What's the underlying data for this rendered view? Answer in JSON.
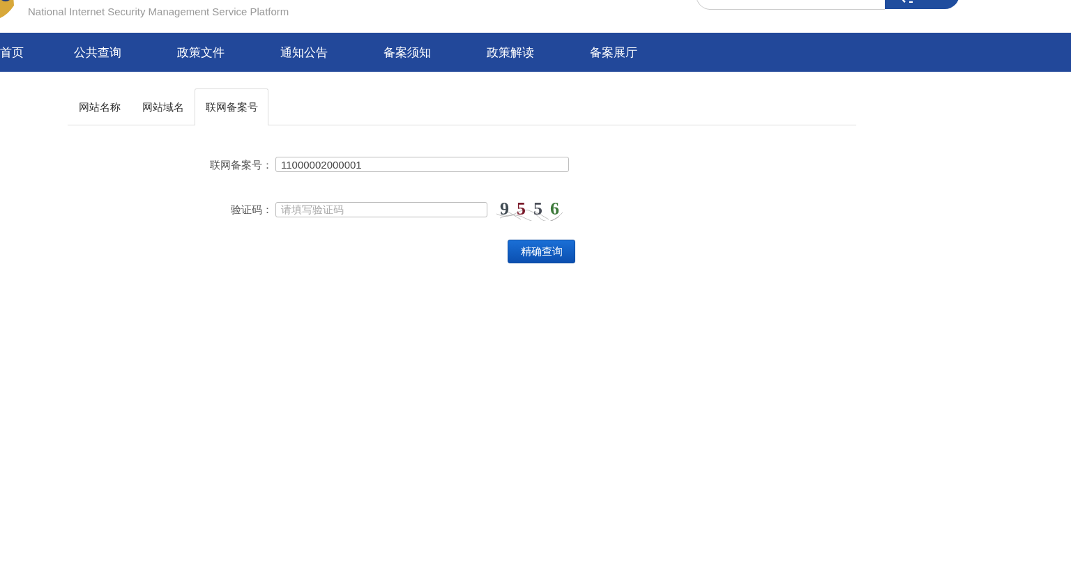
{
  "header": {
    "subtitle": "National Internet Security Management Service Platform"
  },
  "nav": [
    {
      "label": "首页",
      "selected": false
    },
    {
      "label": "公共查询",
      "selected": false
    },
    {
      "label": "政策文件",
      "selected": false
    },
    {
      "label": "通知公告",
      "selected": false
    },
    {
      "label": "备案须知",
      "selected": false
    },
    {
      "label": "政策解读",
      "selected": false
    },
    {
      "label": "备案展厅",
      "selected": false
    }
  ],
  "tabs": [
    {
      "label": "网站名称",
      "selected": false
    },
    {
      "label": "网站域名",
      "selected": false
    },
    {
      "label": "联网备案号",
      "selected": true
    }
  ],
  "form": {
    "record_label": "联网备案号：",
    "record_value": "11000002000001",
    "captcha_label": "验证码：",
    "captcha_placeholder": "请填写验证码",
    "captcha": [
      {
        "text": "9",
        "color": "#3f4a52"
      },
      {
        "text": "5",
        "color": "#7a1a2a"
      },
      {
        "text": "5",
        "color": "#4a4e58"
      },
      {
        "text": "6",
        "color": "#3d7a3a"
      }
    ],
    "submit": "精确查询"
  }
}
